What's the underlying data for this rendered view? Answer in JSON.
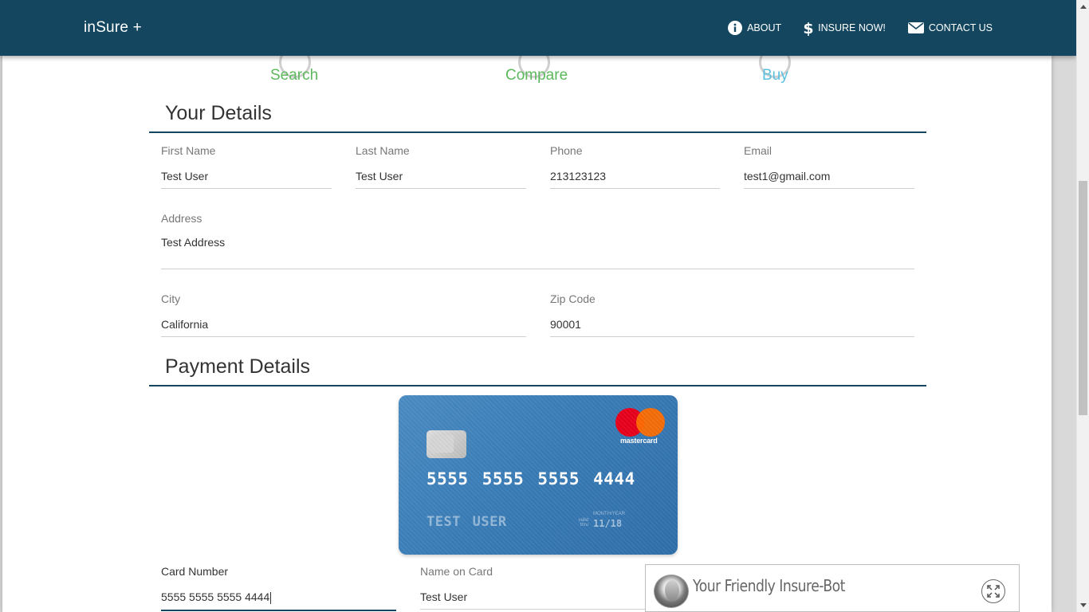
{
  "navbar": {
    "brand": "inSure +",
    "links": [
      {
        "label": "ABOUT",
        "icon": "info-circle-icon"
      },
      {
        "label": "INSURE NOW!",
        "icon": "dollar-icon"
      },
      {
        "label": "CONTACT US",
        "icon": "envelope-icon"
      }
    ]
  },
  "steps": [
    {
      "label": "Search",
      "color": "#5cb85c"
    },
    {
      "label": "Compare",
      "color": "#5cb85c"
    },
    {
      "label": "Buy",
      "color": "#5bc0de"
    }
  ],
  "your_details": {
    "title": "Your Details",
    "first_name": {
      "label": "First Name",
      "value": "Test User"
    },
    "last_name": {
      "label": "Last Name",
      "value": "Test User"
    },
    "phone": {
      "label": "Phone",
      "value": "213123123"
    },
    "email": {
      "label": "Email",
      "value": "test1@gmail.com"
    },
    "address": {
      "label": "Address",
      "value": "Test Address"
    },
    "city": {
      "label": "City",
      "value": "California"
    },
    "zip": {
      "label": "Zip Code",
      "value": "90001"
    }
  },
  "payment_details": {
    "title": "Payment Details",
    "card": {
      "brand": "mastercard",
      "number": "5555 5555 5555 4444",
      "name": "TEST USER",
      "valid_label": "valid thru",
      "month_year_label": "MONTH/YEAR",
      "expiry": "11/18"
    },
    "card_number": {
      "label": "Card Number",
      "value": "5555 5555 5555 4444"
    },
    "name_on_card": {
      "label": "Name on Card",
      "value": "Test User"
    }
  },
  "chatbot": {
    "title": "Your Friendly Insure-Bot",
    "icon": "expand-icon"
  },
  "colors": {
    "navbar": "#14475f",
    "accent_green": "#5cb85c",
    "accent_blue": "#5bc0de"
  }
}
